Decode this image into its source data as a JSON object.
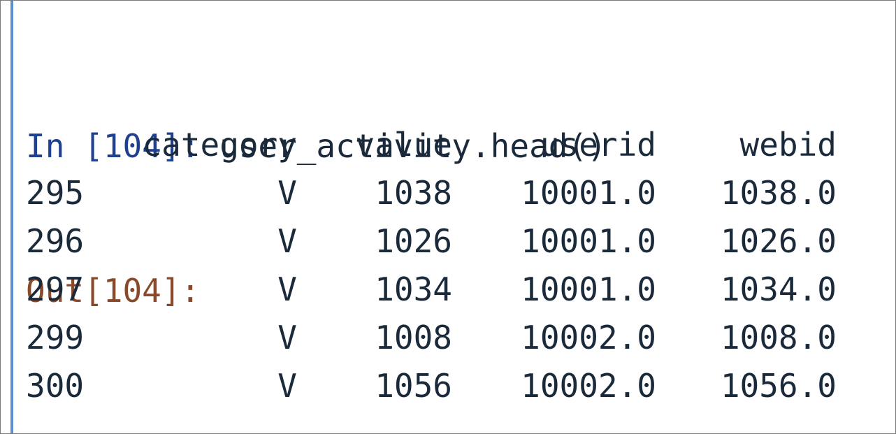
{
  "cell": {
    "input_prompt": "In [104]:",
    "input_code": "user_activity.head()",
    "output_prompt": "Out[104]:"
  },
  "dataframe": {
    "columns": [
      "category",
      "value",
      "userid",
      "webid"
    ],
    "rows": [
      {
        "index": "295",
        "category": "V",
        "value": "1038",
        "userid": "10001.0",
        "webid": "1038.0"
      },
      {
        "index": "296",
        "category": "V",
        "value": "1026",
        "userid": "10001.0",
        "webid": "1026.0"
      },
      {
        "index": "297",
        "category": "V",
        "value": "1034",
        "userid": "10001.0",
        "webid": "1034.0"
      },
      {
        "index": "299",
        "category": "V",
        "value": "1008",
        "userid": "10002.0",
        "webid": "1008.0"
      },
      {
        "index": "300",
        "category": "V",
        "value": "1056",
        "userid": "10002.0",
        "webid": "1056.0"
      }
    ]
  },
  "colors": {
    "input_prompt": "#1f3f8f",
    "output_prompt": "#8a4a2a",
    "cell_bar": "#5b8fcf",
    "text": "#1b2a3a"
  }
}
